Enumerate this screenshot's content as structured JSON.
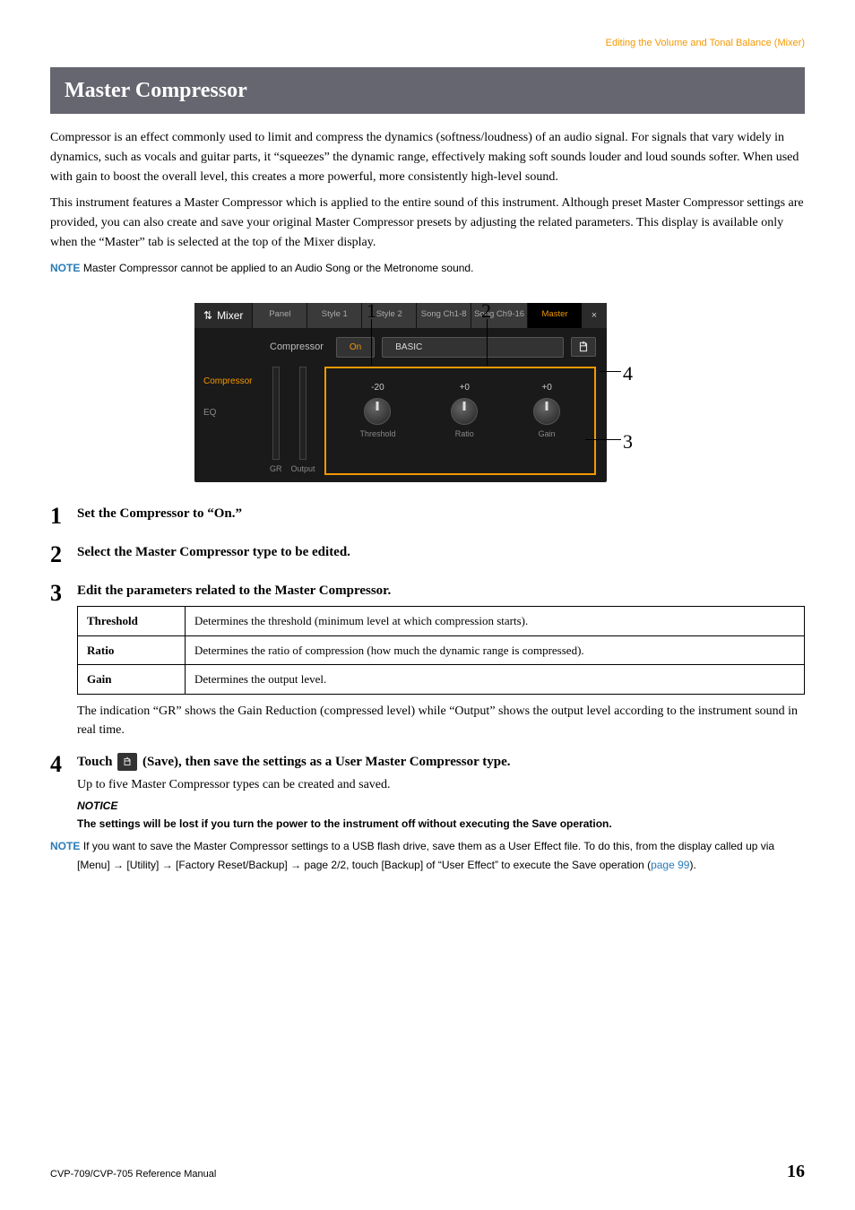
{
  "breadcrumb": "Editing the Volume and Tonal Balance (Mixer)",
  "section_title": "Master Compressor",
  "intro_p1": "Compressor is an effect commonly used to limit and compress the dynamics (softness/loudness) of an audio signal. For signals that vary widely in dynamics, such as vocals and guitar parts, it “squeezes” the dynamic range, effectively making soft sounds louder and loud sounds softer. When used with gain to boost the overall level, this creates a more powerful, more consistently high-level sound.",
  "intro_p2": "This instrument features a Master Compressor which is applied to the entire sound of this instrument. Although preset Master Compressor settings are provided, you can also create and save your original Master Compressor presets by adjusting the related parameters. This display is available only when the “Master” tab is selected at the top of the Mixer display.",
  "note1_label": "NOTE",
  "note1_text": "Master Compressor cannot be applied to an Audio Song or the Metronome sound.",
  "callouts": {
    "c1": "1",
    "c2": "2",
    "c3": "3",
    "c4": "4"
  },
  "mixer": {
    "title": "Mixer",
    "tabs": [
      "Panel",
      "Style 1",
      "Style 2",
      "Song Ch1-8",
      "Song Ch9-16",
      "Master"
    ],
    "close": "×",
    "side": [
      "Compressor",
      "EQ"
    ],
    "compressor_label": "Compressor",
    "on_label": "On",
    "type_label": "BASIC",
    "knobs": {
      "threshold": {
        "val": "-20",
        "name": "Threshold"
      },
      "ratio": {
        "val": "+0",
        "name": "Ratio"
      },
      "gain": {
        "val": "+0",
        "name": "Gain"
      }
    },
    "meters": {
      "gr": "GR",
      "output": "Output"
    }
  },
  "steps": {
    "s1": {
      "num": "1",
      "head": "Set the Compressor to “On.”"
    },
    "s2": {
      "num": "2",
      "head": "Select the Master Compressor type to be edited."
    },
    "s3": {
      "num": "3",
      "head": "Edit the parameters related to the Master Compressor."
    },
    "s4": {
      "num": "4",
      "head_a": "Touch ",
      "head_b": " (Save), then save the settings as a User Master Compressor type.",
      "sub": "Up to five Master Compressor types can be created and saved.",
      "notice_label": "NOTICE",
      "notice_text": "The settings will be lost if you turn the power to the instrument off without executing the Save operation.",
      "note_label": "NOTE",
      "note_text_a": "If you want to save the Master Compressor settings to a USB flash drive, save them as a User Effect file. To do this, from the display called up via [Menu] → [Utility] → [Factory Reset/Backup] → page 2/2, touch [Backup] of “User Effect” to execute the Save operation (",
      "note_link": "page 99",
      "note_text_b": ")."
    }
  },
  "params": [
    {
      "name": "Threshold",
      "desc": "Determines the threshold (minimum level at which compression starts)."
    },
    {
      "name": "Ratio",
      "desc": "Determines the ratio of compression (how much the dynamic range is compressed)."
    },
    {
      "name": "Gain",
      "desc": "Determines the output level."
    }
  ],
  "after_table": "The indication “GR” shows the Gain Reduction (compressed level) while “Output” shows the output level according to the instrument sound in real time.",
  "footer": {
    "ref": "CVP-709/CVP-705 Reference Manual",
    "page": "16"
  }
}
